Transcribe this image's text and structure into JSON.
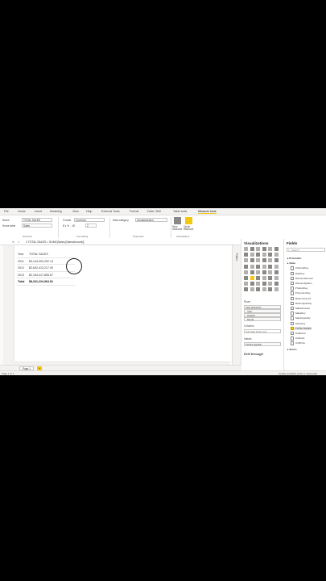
{
  "menu": {
    "items": [
      "File",
      "Home",
      "Insert",
      "Modeling",
      "View",
      "Help",
      "External Tools",
      "Format",
      "Data / Drill",
      "Table tools",
      "Measure tools"
    ],
    "active_index": 10
  },
  "ribbon": {
    "name_label": "Name",
    "name_value": "TOTAL SALES",
    "home_table_label": "Home table",
    "home_table_value": "Sales",
    "structure_label": "Structure",
    "format_label": "Format",
    "format_value": "Currency",
    "decimal_value": "2",
    "formatting_label": "Formatting",
    "data_category_label": "Data category",
    "data_category_value": "Uncategorized",
    "properties_label": "Properties",
    "new_measure_label": "New measure",
    "quick_measure_label": "Quick measure",
    "calculations_label": "Calculations"
  },
  "formula": {
    "text": "1  TOTAL SALES = SUMX(Sales,[SalesAmount])"
  },
  "table": {
    "headers": [
      "Year",
      "TOTAL SALES"
    ],
    "rows": [
      {
        "year": "2011",
        "value": "$3,144,392,292.13"
      },
      {
        "year": "2012",
        "value": "$2,642,413,217.00"
      },
      {
        "year": "2013",
        "value": "$2,154,417,855.67"
      }
    ],
    "total": {
      "label": "Total",
      "value": "$8,341,224,364.81"
    }
  },
  "pages": {
    "tabs": [
      "Page 1"
    ],
    "add_label": "+"
  },
  "status": {
    "left": "Page 1 of 1",
    "right": "Update available (click to download)"
  },
  "filters": {
    "label": "Filters"
  },
  "visualizations": {
    "title": "Visualizations",
    "rows_label": "Rows",
    "rows_items": [
      "Year Hierarchy",
      "Year",
      "Quarter",
      "Month"
    ],
    "columns_label": "Columns",
    "columns_placeholder": "Add data fields here",
    "values_label": "Values",
    "values_items": [
      "TOTAL SALES"
    ],
    "drill_label": "Drill through"
  },
  "fields_panel": {
    "title": "Fields",
    "search_placeholder": "Search",
    "groups": [
      "Promotion",
      "Sales"
    ],
    "items": [
      "ChannelKey",
      "DateKey",
      "DiscountAmount",
      "DiscountQuant...",
      "ProductKey",
      "PromotionKey",
      "ReturnAmount",
      "ReturnQuantity",
      "SalesAmount",
      "SalesKey",
      "SalesQuantity",
      "StoreKey",
      "TOTAL SALES",
      "TotalCost",
      "UnitCost",
      "UnitPrice"
    ],
    "selected_item": "TOTAL SALES",
    "bottom_group": "Stores"
  },
  "colors": {
    "accent": "#f2c811",
    "background": "#000000"
  }
}
